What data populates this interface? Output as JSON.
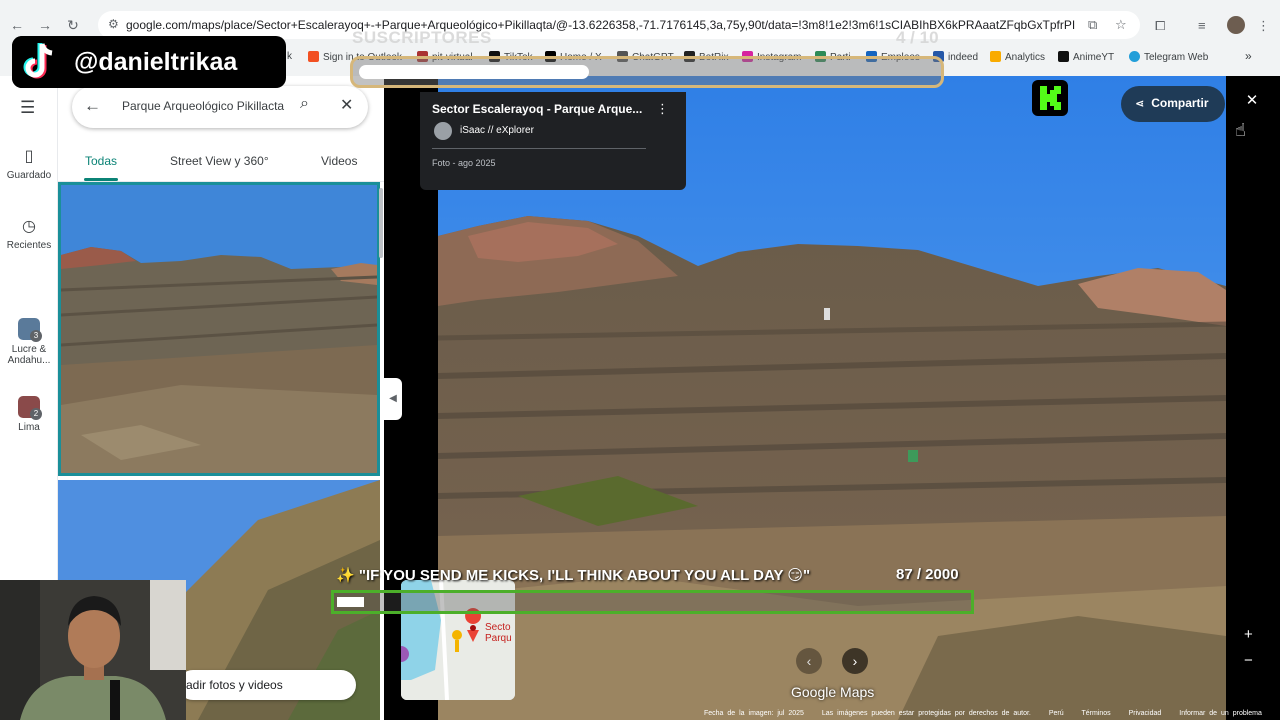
{
  "browser": {
    "url": "google.com/maps/place/Sector+Escalerayoq+-+Parque+Arqueológico+Pikillaqta/@-13.6226358,-71.7176145,3a,75y,90t/data=!3m8!1e2!3m6!1sCIABIhBX6kPRAaatZFqbGxTpfrPI!2e10!3e12!6s...",
    "bookmarks": [
      "k",
      "Sign in to Outlook",
      "pit-virtual",
      "TikTok",
      "Home / X",
      "ChatGPT",
      "BotRix",
      "Instagram",
      "Parti",
      "Empleos",
      "indeed",
      "Analytics",
      "AnimeYT",
      "Telegram Web"
    ]
  },
  "overlay": {
    "subs_title": "SUSCRIPTORES",
    "subs_count": "4 / 10",
    "tiktok_handle": "@danieltrikaa",
    "chat_message": "✨ \"IF YOU SEND ME KICKS, I'LL THINK ABOUT YOU ALL DAY 😏\"",
    "chat_count": "87  / 2000",
    "subs_progress": 0.4,
    "chat_progress": 0.0435
  },
  "rail": {
    "items": [
      {
        "label": "Guardado"
      },
      {
        "label": "Recientes"
      },
      {
        "label": "Lucre & Andahu...",
        "badge": "3"
      },
      {
        "label": "Lima",
        "badge": "2"
      }
    ]
  },
  "panel": {
    "search_value": "Parque Arqueológico Pikillacta",
    "tabs": [
      "Todas",
      "Street View y 360°",
      "Videos"
    ],
    "add_photos": "adir fotos y videos"
  },
  "viewer": {
    "title": "Sector Escalerayoq - Parque Arque...",
    "author": "iSaac // eXplorer",
    "date": "Foto - ago 2025",
    "share_label": "Compartir",
    "minimap_label": "Secto Parqu",
    "brand": "Google Maps",
    "footer": [
      "Fecha de la imagen: jul 2025",
      "Las imágenes pueden estar protegidas por derechos de autor.",
      "Perú",
      "Términos",
      "Privacidad",
      "Informar de un problema"
    ]
  },
  "colors": {
    "accent": "#0b8376",
    "share_bg": "#1f3b57",
    "chat_border": "#4caf2a",
    "kick_green": "#53fc18"
  }
}
